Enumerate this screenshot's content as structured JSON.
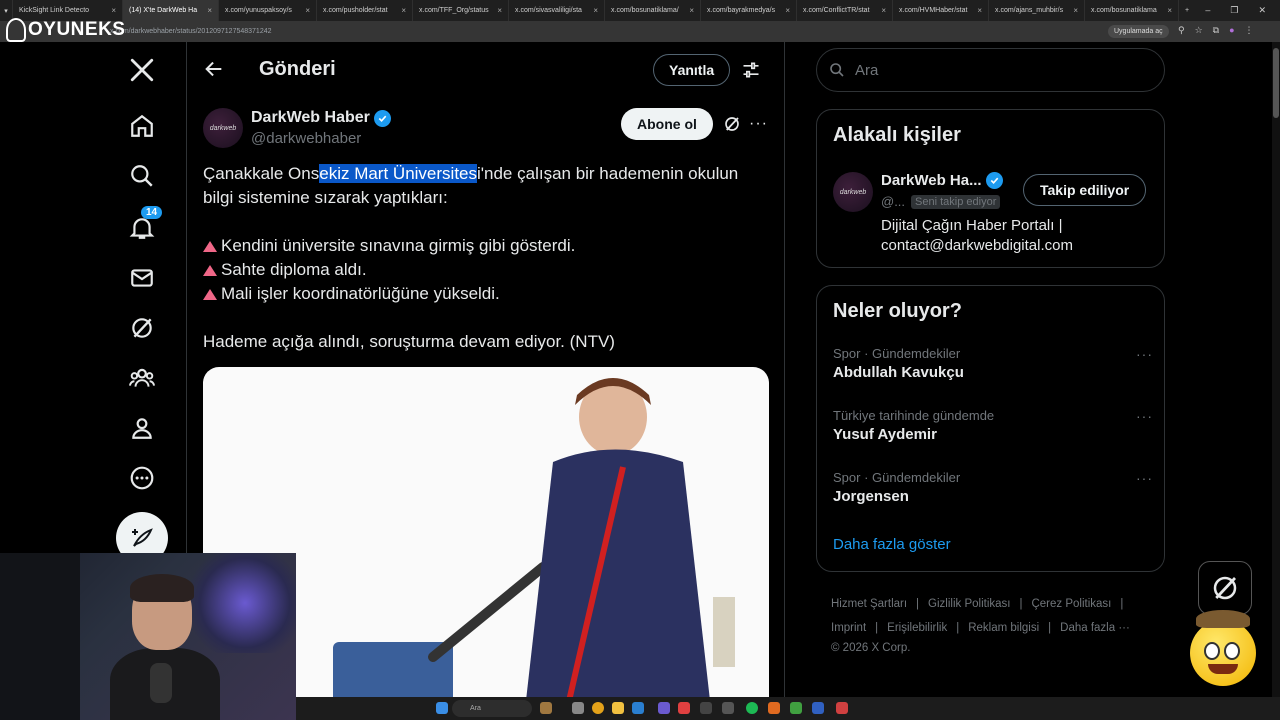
{
  "browser": {
    "tabs": [
      {
        "label": "KickSight Link Detecto",
        "active": false
      },
      {
        "label": "(14) X'te DarkWeb Ha",
        "active": true
      },
      {
        "label": "x.com/yunuspaksoy/s",
        "active": false
      },
      {
        "label": "x.com/pusholder/stat",
        "active": false
      },
      {
        "label": "x.com/TFF_Org/status",
        "active": false
      },
      {
        "label": "x.com/sivasvaliligi/sta",
        "active": false
      },
      {
        "label": "x.com/bosunatiklama/",
        "active": false
      },
      {
        "label": "x.com/bayrakmedya/s",
        "active": false
      },
      {
        "label": "x.com/ConflictTR/stat",
        "active": false
      },
      {
        "label": "x.com/HVMHaber/stat",
        "active": false
      },
      {
        "label": "x.com/ajans_muhbir/s",
        "active": false
      },
      {
        "label": "x.com/bosunatiklama",
        "active": false
      }
    ],
    "url": "x.com/darkwebhaber/status/2012097127548371242",
    "open_in_app": "Uygulamada aç"
  },
  "watermark": "OYUNEKS",
  "nav": {
    "notifications_badge": "14",
    "icons": [
      "x-logo-icon",
      "home-icon",
      "search-icon",
      "bell-icon",
      "mail-icon",
      "grok-icon",
      "communities-icon",
      "profile-icon",
      "more-circle-icon"
    ]
  },
  "header": {
    "title": "Gönderi",
    "reply_label": "Yanıtla"
  },
  "post": {
    "author_name": "DarkWeb Haber",
    "author_handle": "@darkwebhaber",
    "avatar_text": "darkweb",
    "subscribe_label": "Abone ol",
    "text_before": "Çanakkale Ons",
    "text_highlight": "ekiz Mart Üniversites",
    "text_after": "i'nde çalışan bir hademenin okulun bilgi sistemine sızarak yaptıkları:",
    "bullets": [
      "Kendini üniversite sınavına girmiş gibi gösterdi.",
      "Sahte diploma aldı.",
      "Mali işler koordinatörlüğüne yükseldi."
    ],
    "closing": "Hademe açığa alındı, soruşturma devam ediyor. (NTV)"
  },
  "search": {
    "placeholder": "Ara"
  },
  "related": {
    "title": "Alakalı kişiler",
    "name": "DarkWeb Ha...",
    "handle": "@...",
    "follows_you": "Seni takip ediyor",
    "follow_label": "Takip ediliyor",
    "bio": "Dijital Çağın Haber Portalı | contact@darkwebdigital.com"
  },
  "trends": {
    "title": "Neler oluyor?",
    "items": [
      {
        "meta": "Spor · Gündemdekiler",
        "name": "Abdullah Kavukçu"
      },
      {
        "meta": "Türkiye tarihinde gündemde",
        "name": "Yusuf Aydemir"
      },
      {
        "meta": "Spor · Gündemdekiler",
        "name": "Jorgensen"
      }
    ],
    "show_more": "Daha fazla göster"
  },
  "footer": {
    "links": [
      "Hizmet Şartları",
      "Gizlilik Politikası",
      "Çerez Politikası",
      "Imprint",
      "Erişilebilirlik",
      "Reklam bilgisi",
      "Daha fazla ···"
    ],
    "copyright": "© 2026 X Corp."
  },
  "taskbar": {
    "search_label": "Ara"
  },
  "colors": {
    "accent": "#1d9bf0",
    "highlight": "#0a58c9",
    "bullet": "#f06788"
  }
}
